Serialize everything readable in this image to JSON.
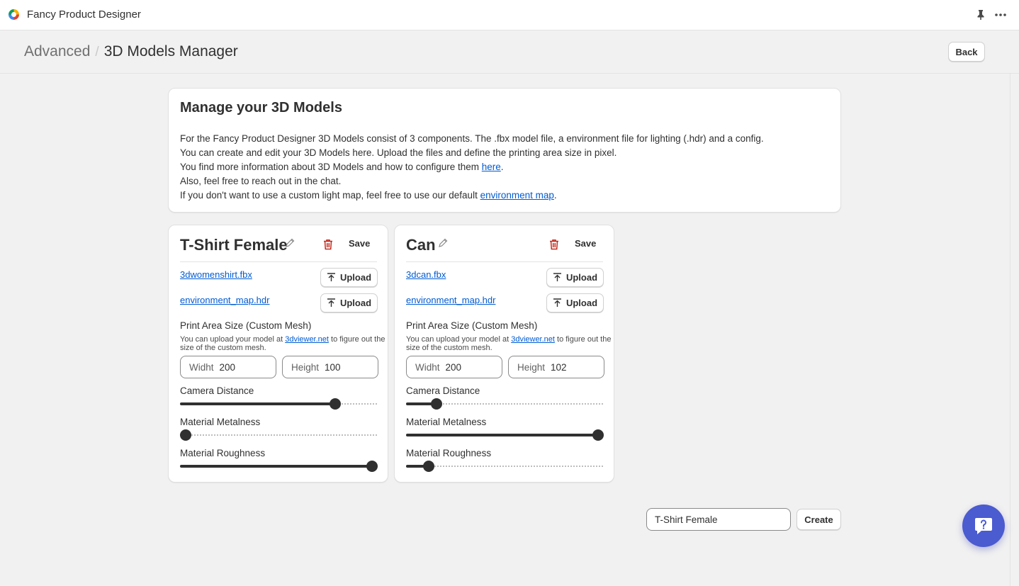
{
  "app": {
    "title": "Fancy Product Designer"
  },
  "header": {
    "breadcrumb_parent": "Advanced",
    "separator": "/",
    "title": "3D Models Manager",
    "back_label": "Back"
  },
  "info": {
    "title": "Manage your 3D Models",
    "line1": "For the Fancy Product Designer 3D Models consist of 3 components. The .fbx model file, a environment file for lighting (.hdr) and a config.",
    "line2": "You can create and edit your 3D Models here. Upload the files and define the printing area size in pixel.",
    "line3_prefix": "You find more information about 3D Models and how to configure them ",
    "line3_link": "here",
    "line3_suffix": ".",
    "line4": "Also, feel free to reach out in the chat.",
    "line5_prefix": "If you don't want to use a custom light map, feel free to use our default ",
    "line5_link": "environment map",
    "line5_suffix": "."
  },
  "models": [
    {
      "name": "T-Shirt Female",
      "save_label": "Save",
      "model_file": "3dwomenshirt.fbx",
      "env_file": "environment_map.hdr",
      "upload_label": "Upload",
      "print_area_label": "Print Area Size (Custom Mesh)",
      "help_prefix": "You can upload your model at ",
      "help_link": "3dviewer.net",
      "help_suffix": " to figure out the size of the custom mesh.",
      "width_prefix": "Widht",
      "width_value": "200",
      "height_prefix": "Height",
      "height_value": "100",
      "camera_label": "Camera Distance",
      "camera_level": 0.785,
      "metalness_label": "Material Metalness",
      "metalness_level": 0.03,
      "roughness_label": "Material Roughness",
      "roughness_level": 0.972
    },
    {
      "name": "Can",
      "save_label": "Save",
      "model_file": "3dcan.fbx",
      "env_file": "environment_map.hdr",
      "upload_label": "Upload",
      "print_area_label": "Print Area Size (Custom Mesh)",
      "help_prefix": "You can upload your model at ",
      "help_link": "3dviewer.net",
      "help_suffix": " to figure out the size of the custom mesh.",
      "width_prefix": "Widht",
      "width_value": "200",
      "height_prefix": "Height",
      "height_value": "102",
      "camera_label": "Camera Distance",
      "camera_level": 0.154,
      "metalness_label": "Material Metalness",
      "metalness_level": 0.97,
      "roughness_label": "Material Roughness",
      "roughness_level": 0.115
    }
  ],
  "create": {
    "input_value": "T-Shirt Female",
    "button_label": "Create"
  },
  "colors": {
    "link": "#005bd3",
    "danger": "#c4281c",
    "chat": "#4b5bd0"
  }
}
